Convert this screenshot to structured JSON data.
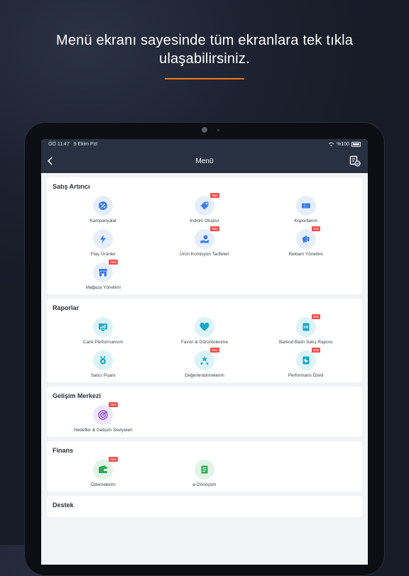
{
  "headline": {
    "line1": "Menü ekranı sayesinde tüm ekranlara tek tıkla",
    "line2": "ulaşabilirsiniz."
  },
  "colors": {
    "accent": "#f27a1a",
    "navbar": "#273142",
    "badge": "#f04e4e",
    "blue_icon": "#3d7fe8",
    "teal_icon": "#1aa8c6",
    "purple_icon": "#8a4bd8",
    "green_icon": "#2eaa58"
  },
  "status_bar": {
    "time": "ÖÖ 11:47",
    "date": "9 Ekim Pzt",
    "battery": "%100"
  },
  "nav": {
    "title": "Menü"
  },
  "badge_label": "Yeni",
  "sections": [
    {
      "title": "Satış Artırıcı",
      "items": [
        {
          "label": "Kampanyalar",
          "icon": "percent-icon",
          "badge": false
        },
        {
          "label": "İndirim Oluştur",
          "icon": "tag-icon",
          "badge": true
        },
        {
          "label": "Kuponlarım",
          "icon": "coupon-icon",
          "badge": false
        },
        {
          "label": "Flaş Ürünler",
          "icon": "lightning-icon",
          "badge": false
        },
        {
          "label": "Ürün Komisyon Tarifeleri",
          "icon": "commission-icon",
          "badge": true
        },
        {
          "label": "Reklam Yönetimi",
          "icon": "megaphone-icon",
          "badge": true
        },
        {
          "label": "Mağaza Yönetimi",
          "icon": "store-icon",
          "badge": true
        }
      ]
    },
    {
      "title": "Raporlar",
      "items": [
        {
          "label": "Canlı Performansım",
          "icon": "monitor-chart-icon",
          "badge": false
        },
        {
          "label": "Favori & Görüntülenme",
          "icon": "heart-icon",
          "badge": false
        },
        {
          "label": "Barkod Bazlı Satış Raporu",
          "icon": "barcode-report-icon",
          "badge": true
        },
        {
          "label": "Satıcı Puanı",
          "icon": "medal-icon",
          "badge": false
        },
        {
          "label": "Değerlendirmelerim",
          "icon": "stars-icon",
          "badge": true
        },
        {
          "label": "Performans Özeti",
          "icon": "pie-report-icon",
          "badge": true
        }
      ]
    },
    {
      "title": "Gelişim Merkezi",
      "items": [
        {
          "label": "Hedefler & Gelişim Seviyeleri",
          "icon": "target-icon",
          "badge": true
        }
      ]
    },
    {
      "title": "Finans",
      "items": [
        {
          "label": "Ödemelerim",
          "icon": "wallet-icon",
          "badge": true
        },
        {
          "label": "e-Dönüşüm",
          "icon": "document-icon",
          "badge": false
        }
      ]
    },
    {
      "title": "Destek",
      "items": []
    }
  ]
}
